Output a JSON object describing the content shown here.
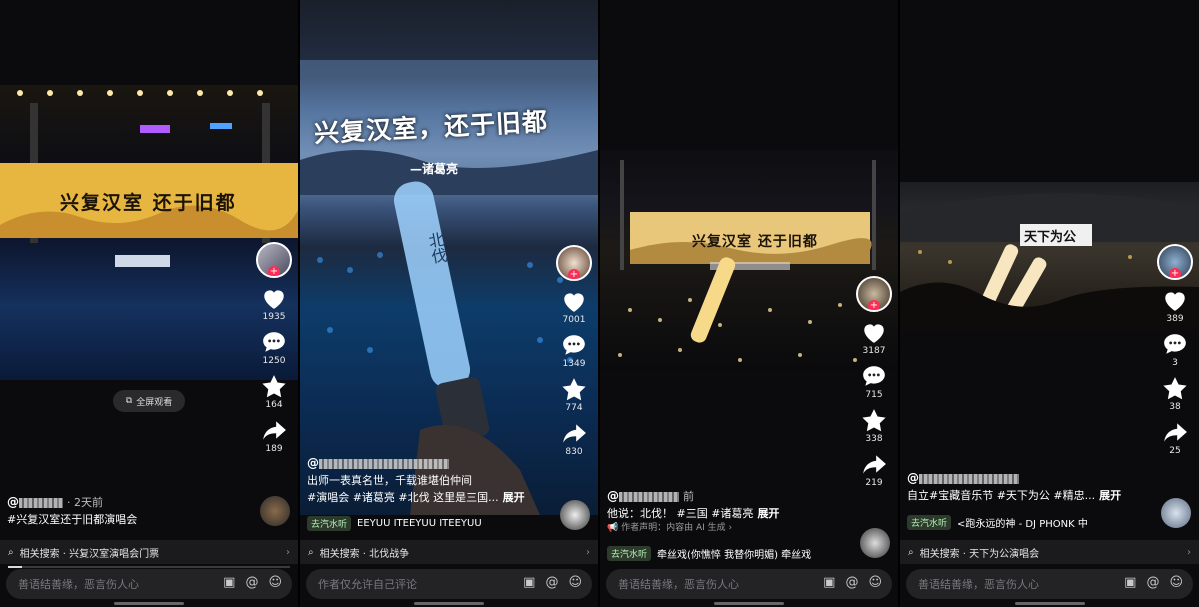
{
  "colors": {
    "like": "#ffffff",
    "accent": "#fe2c55",
    "bar": "#1b1b1e"
  },
  "panels": [
    {
      "banner": "兴复汉室  还于旧都",
      "likes": "1935",
      "comments": "1250",
      "stars": "164",
      "shares": "189",
      "author_time": "· 2天前",
      "caption": "#兴复汉室还于旧都演唱会",
      "fullscreen_label": "全屏观看",
      "search": "相关搜索 · 兴复汉室演唱会门票",
      "comment_placeholder": "善语结善缘，恶言伤人心",
      "progress": 0.05
    },
    {
      "screen_title": "兴复汉室，还于旧都",
      "screen_sub": "—诸葛亮",
      "stick_text": "北伐",
      "likes": "7001",
      "comments": "1349",
      "stars": "774",
      "shares": "830",
      "caption_line1": "出师一表真名世，千载谁堪伯仲间",
      "caption_line2": "#演唱会 #诸葛亮 #北伐  这里是三国...",
      "unfold": "展开",
      "music_tag": "去汽水听",
      "music": "EEYUU    ITEEYUU    ITEEYUU",
      "search": "相关搜索 · 北伐战争",
      "comment_placeholder": "作者仅允许自己评论"
    },
    {
      "banner": "兴复汉室  还于旧都",
      "likes": "3187",
      "comments": "715",
      "stars": "338",
      "shares": "219",
      "author_time": "前",
      "caption": "他说：北伐！ #三国 #诸葛亮",
      "unfold": "展开",
      "statement": "作者声明：内容由 AI 生成",
      "music_tag": "去汽水听",
      "music": "牵丝戏(你憔悴 我替你明媚)    牵丝戏",
      "comment_placeholder": "善语结善缘，恶言伤人心"
    },
    {
      "banner": "天下为公",
      "stick_text": "天下为公",
      "likes": "389",
      "comments": "3",
      "stars": "38",
      "shares": "25",
      "caption": "自立#宝藏音乐节 #天下为公 #精忠...",
      "unfold": "展开",
      "music_tag": "去汽水听",
      "music": "<跑永远的神 - DJ PHONK    中",
      "search": "相关搜索 · 天下为公演唱会",
      "comment_placeholder": "善语结善缘，恶言伤人心"
    }
  ]
}
